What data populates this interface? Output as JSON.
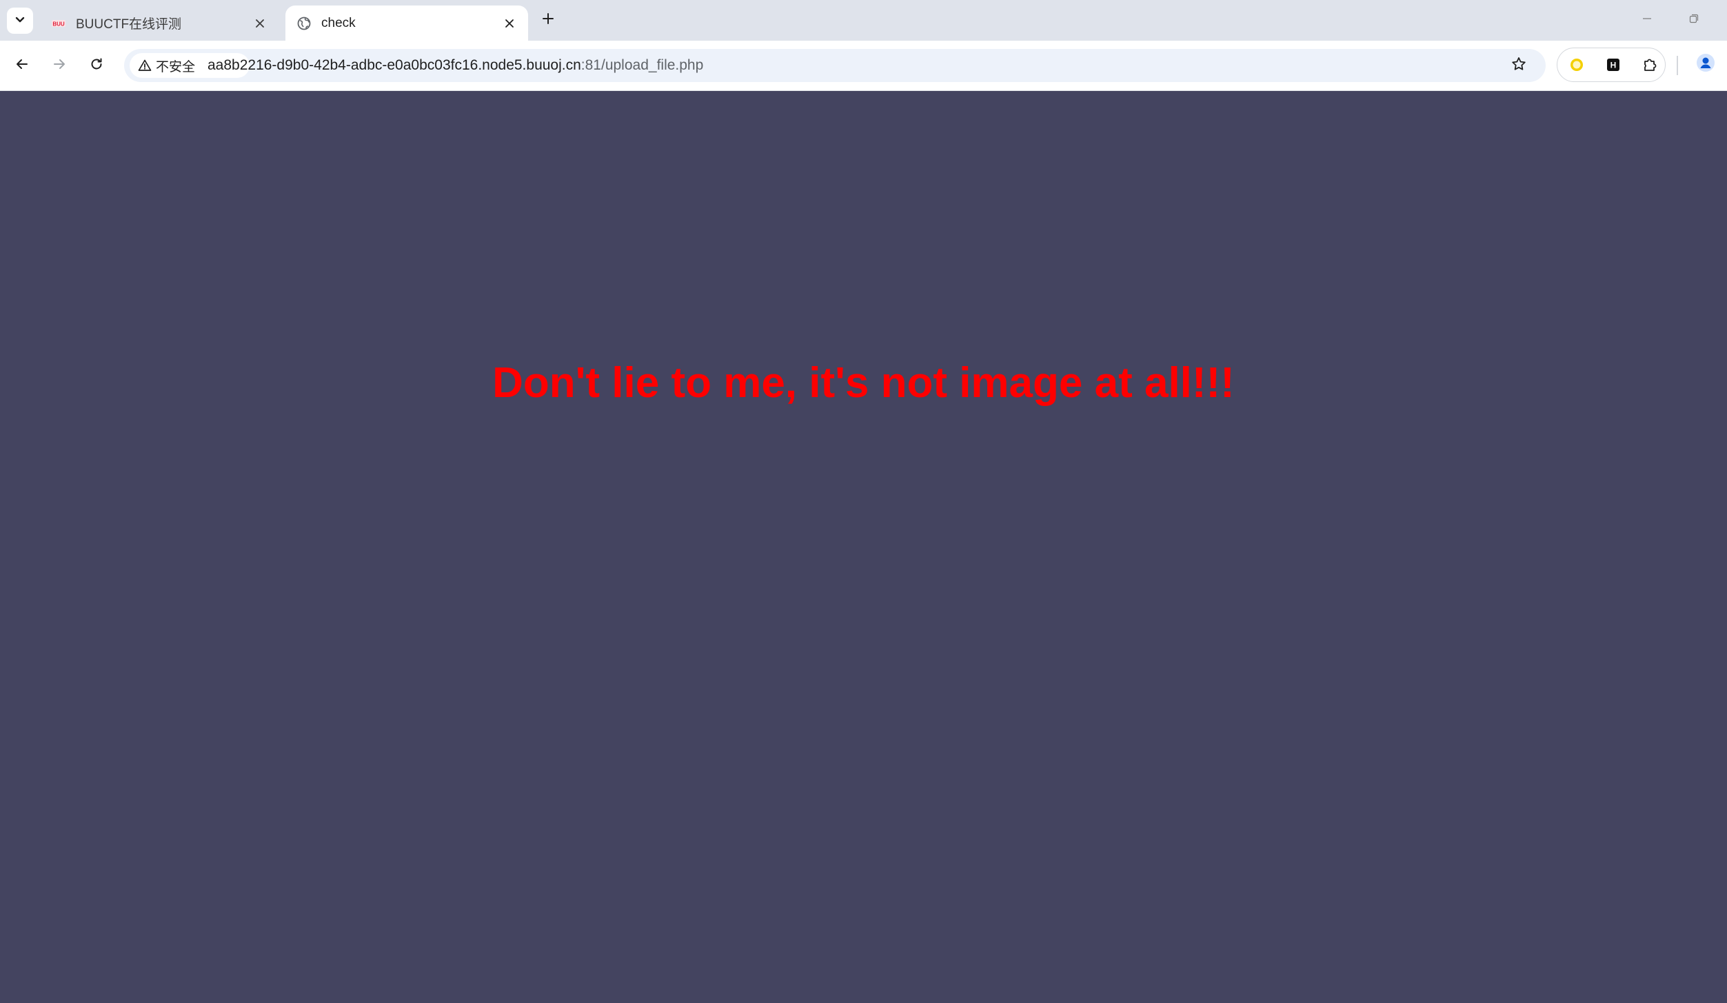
{
  "tabs": [
    {
      "title": "BUUCTF在线评测",
      "favicon": "buuctf-favicon-icon",
      "active": false
    },
    {
      "title": "check",
      "favicon": "globe-icon",
      "active": true
    }
  ],
  "toolbar": {
    "security_label": "不安全",
    "url_host": "aa8b2216-d9b0-42b4-adbc-e0a0bc03fc16.node5.buuoj.cn",
    "url_rest": ":81/upload_file.php"
  },
  "page": {
    "message": "Don't lie to me, it's not image at all!!!",
    "message_color": "#ff0000",
    "background_color": "#444460"
  },
  "extensions": [
    "yellow-circle-extension-icon",
    "h-extension-icon",
    "puzzle-extensions-icon"
  ]
}
